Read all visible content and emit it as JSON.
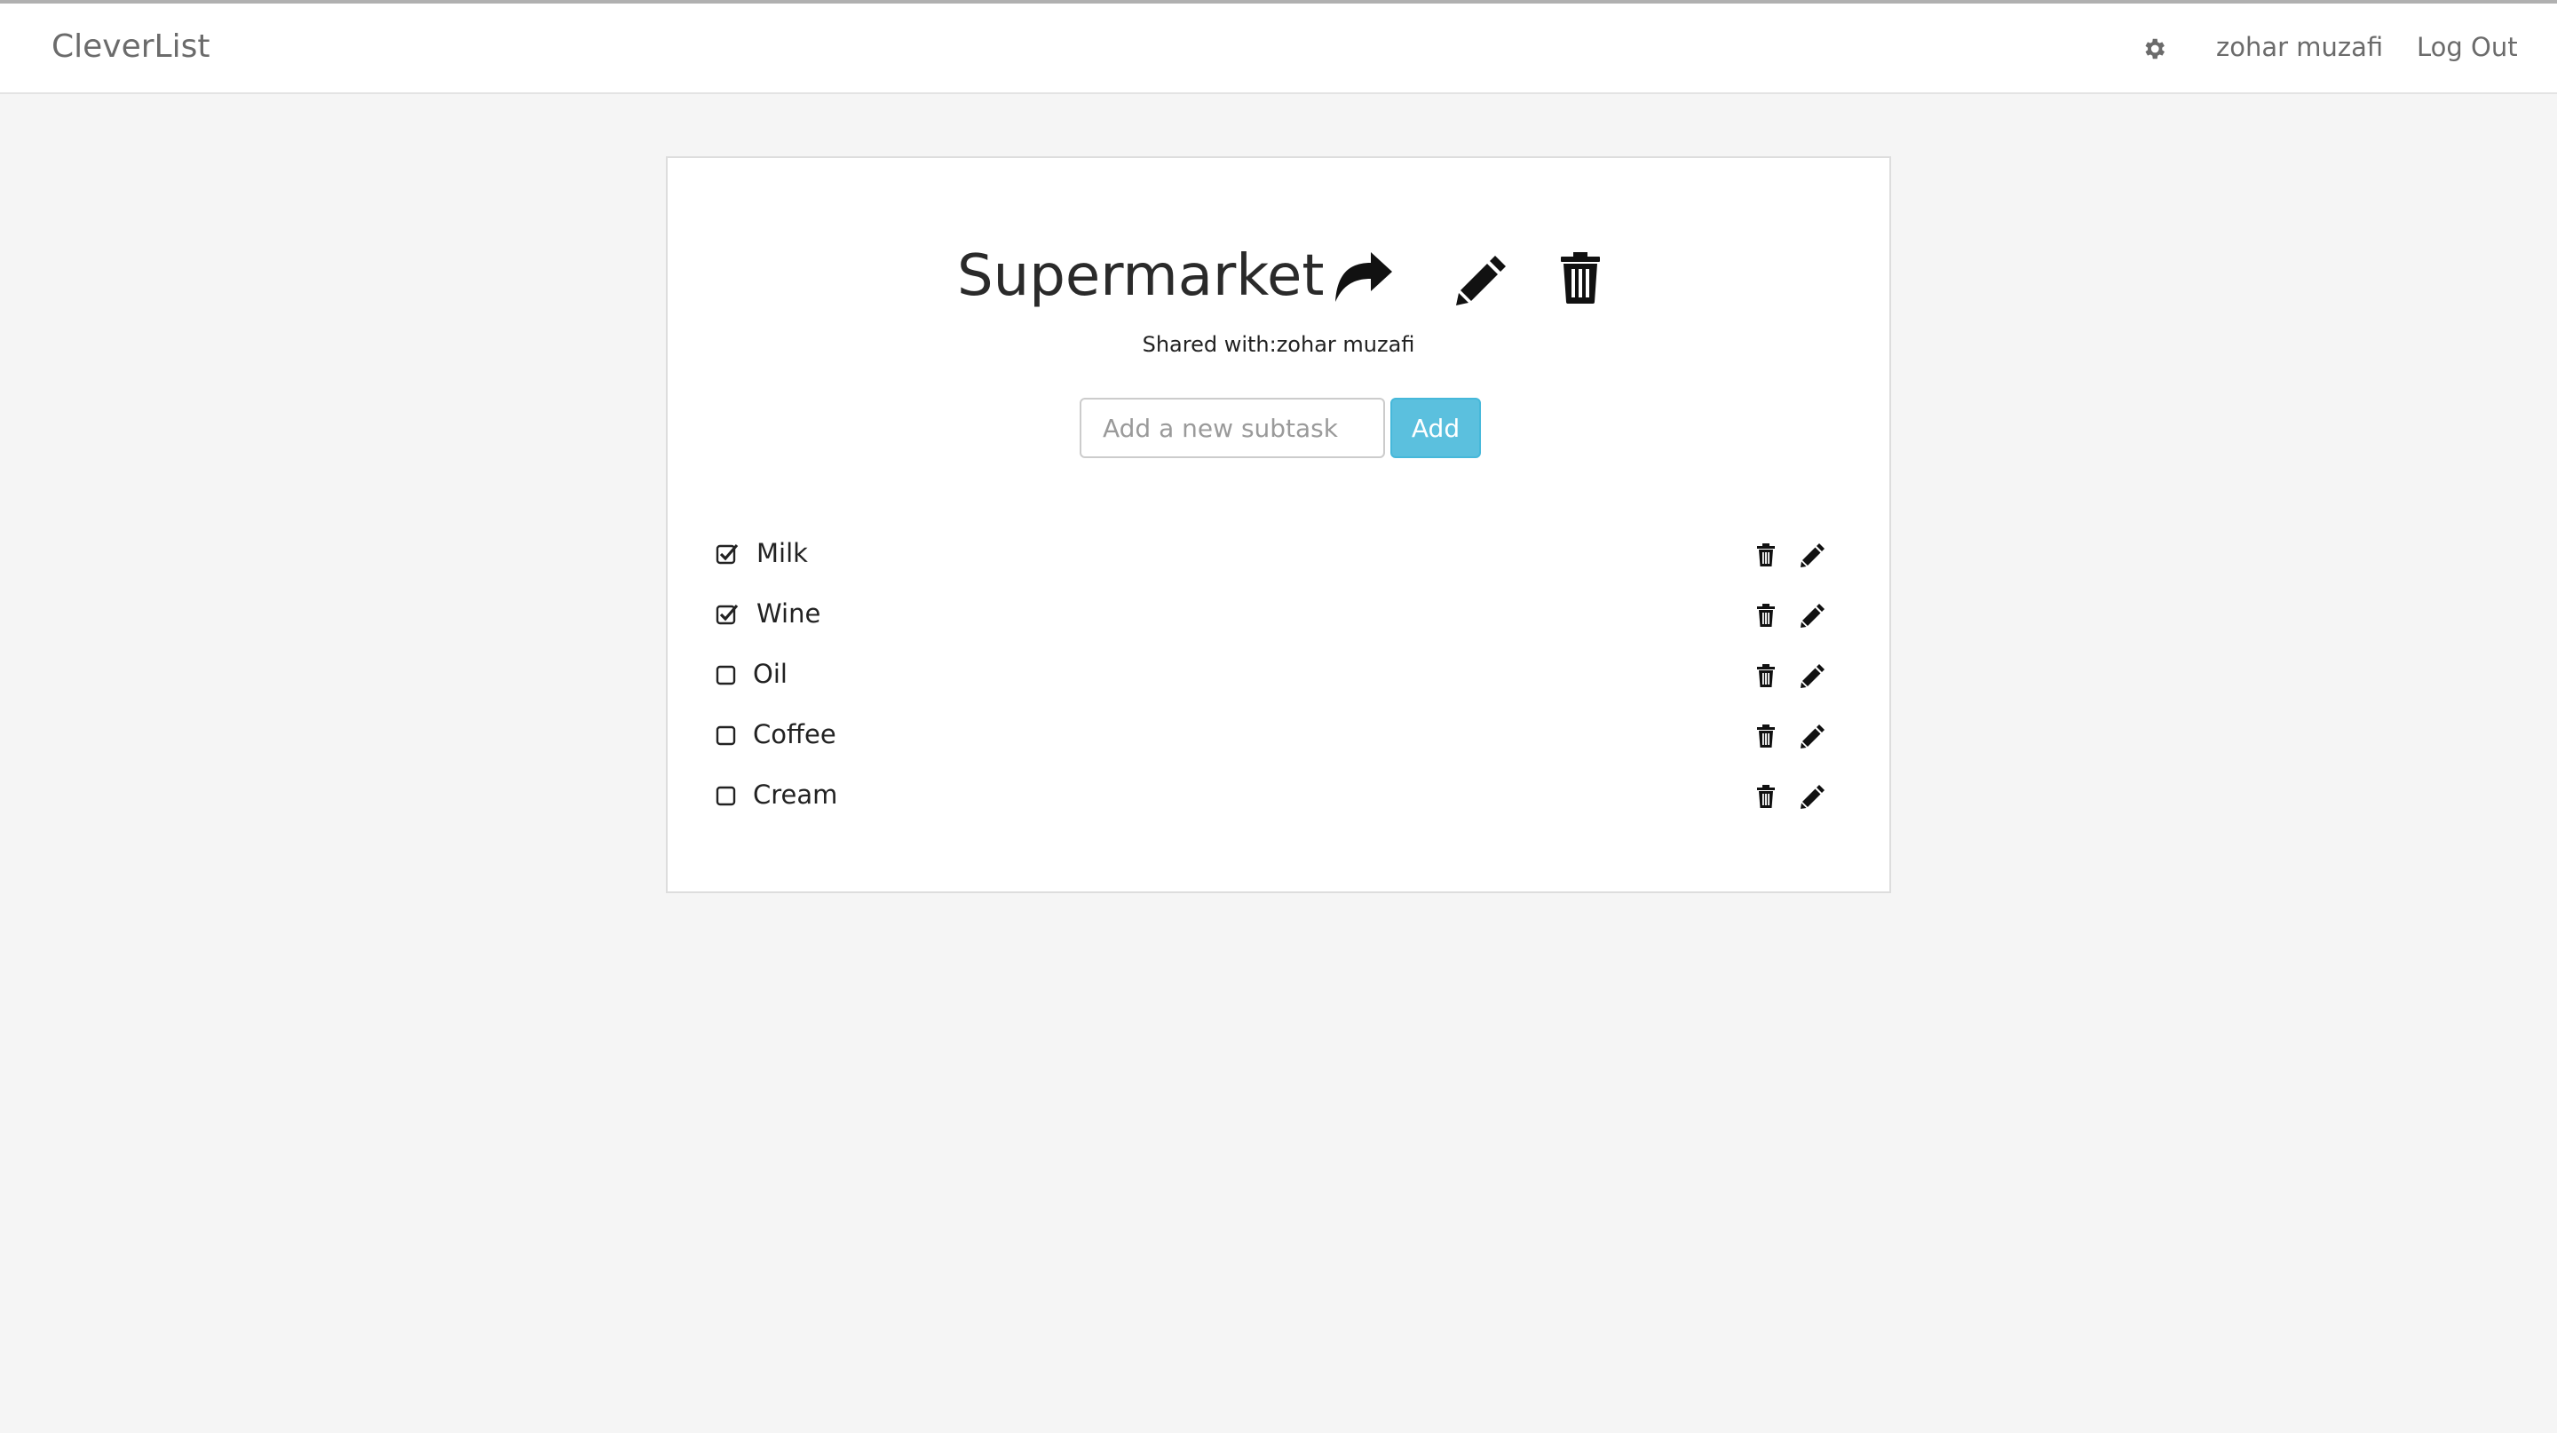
{
  "app": {
    "brand": "CleverList"
  },
  "nav": {
    "settings_icon": "gear-icon",
    "user_name": "zohar muzafi",
    "logout_label": "Log Out"
  },
  "list": {
    "title": "Supermarket",
    "shared_label": "Shared with:zohar muzafi",
    "actions": [
      "share-icon",
      "pencil-icon",
      "trash-icon"
    ]
  },
  "add_form": {
    "placeholder": "Add a new subtask",
    "value": "",
    "button_label": "Add"
  },
  "colors": {
    "accent": "#5bc0de",
    "background": "#f5f5f5"
  },
  "items": [
    {
      "label": "Milk",
      "checked": true
    },
    {
      "label": "Wine",
      "checked": true
    },
    {
      "label": "Oil",
      "checked": false
    },
    {
      "label": "Coffee",
      "checked": false
    },
    {
      "label": "Cream",
      "checked": false
    }
  ]
}
